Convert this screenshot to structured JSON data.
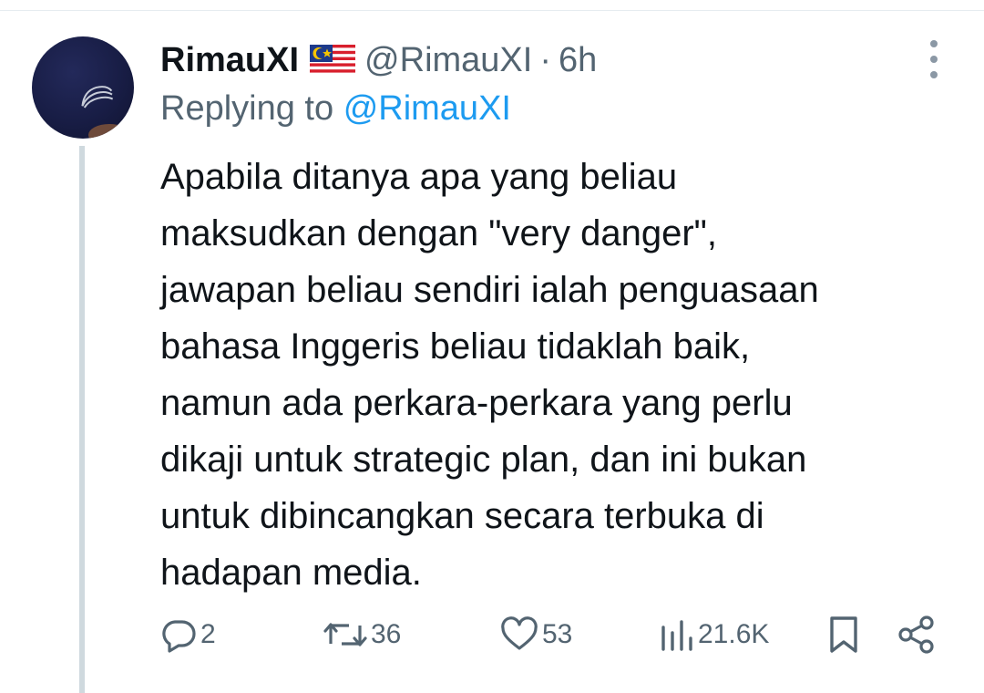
{
  "tweet": {
    "display_name": "RimauXI",
    "flag": "malaysia-flag",
    "handle": "@RimauXI",
    "separator": "·",
    "time": "6h",
    "reply_prefix": "Replying to",
    "reply_to": "@RimauXI",
    "text_lines": [
      "Apabila ditanya apa yang beliau",
      "maksudkan dengan \"very danger\",",
      "jawapan beliau sendiri ialah penguasaan",
      "bahasa Inggeris beliau tidaklah baik,",
      "namun ada perkara-perkara yang perlu",
      "dikaji untuk strategic plan, dan ini bukan",
      "untuk dibincangkan secara terbuka di",
      "hadapan media."
    ]
  },
  "actions": {
    "replies": "2",
    "retweets": "36",
    "likes": "53",
    "views": "21.6K"
  },
  "icons": {
    "reply": "reply-icon",
    "retweet": "retweet-icon",
    "like": "heart-icon",
    "views": "views-icon",
    "bookmark": "bookmark-icon",
    "share": "share-icon",
    "more": "more-icon"
  },
  "colors": {
    "text": "#0f1419",
    "muted": "#536471",
    "link": "#1d9bf0",
    "thread_line": "#cfd9de"
  }
}
